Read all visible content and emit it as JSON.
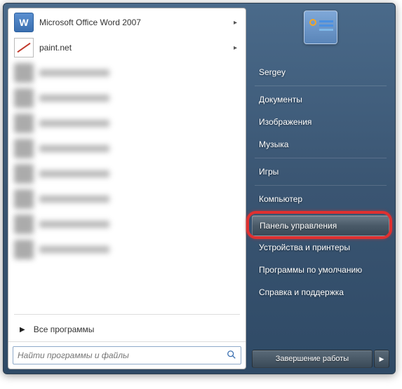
{
  "left": {
    "programs": [
      {
        "label": "Microsoft Office Word 2007",
        "icon": "word",
        "submenu": true,
        "blurred": false
      },
      {
        "label": "paint.net",
        "icon": "paint",
        "submenu": true,
        "blurred": false
      },
      {
        "label": "",
        "icon": "",
        "submenu": false,
        "blurred": true
      },
      {
        "label": "",
        "icon": "",
        "submenu": false,
        "blurred": true
      },
      {
        "label": "",
        "icon": "",
        "submenu": false,
        "blurred": true
      },
      {
        "label": "",
        "icon": "",
        "submenu": false,
        "blurred": true
      },
      {
        "label": "",
        "icon": "",
        "submenu": false,
        "blurred": true
      },
      {
        "label": "",
        "icon": "",
        "submenu": false,
        "blurred": true
      },
      {
        "label": "",
        "icon": "",
        "submenu": false,
        "blurred": true
      },
      {
        "label": "",
        "icon": "",
        "submenu": false,
        "blurred": true
      }
    ],
    "all_programs": "Все программы",
    "search_placeholder": "Найти программы и файлы"
  },
  "right": {
    "items": [
      {
        "label": "Sergey",
        "sep_after": true,
        "highlight": false
      },
      {
        "label": "Документы",
        "sep_after": false,
        "highlight": false
      },
      {
        "label": "Изображения",
        "sep_after": false,
        "highlight": false
      },
      {
        "label": "Музыка",
        "sep_after": true,
        "highlight": false
      },
      {
        "label": "Игры",
        "sep_after": true,
        "highlight": false
      },
      {
        "label": "Компьютер",
        "sep_after": true,
        "highlight": false
      },
      {
        "label": "Панель управления",
        "sep_after": false,
        "highlight": true
      },
      {
        "label": "Устройства и принтеры",
        "sep_after": false,
        "highlight": false
      },
      {
        "label": "Программы по умолчанию",
        "sep_after": false,
        "highlight": false
      },
      {
        "label": "Справка и поддержка",
        "sep_after": false,
        "highlight": false
      }
    ],
    "shutdown": "Завершение работы"
  }
}
